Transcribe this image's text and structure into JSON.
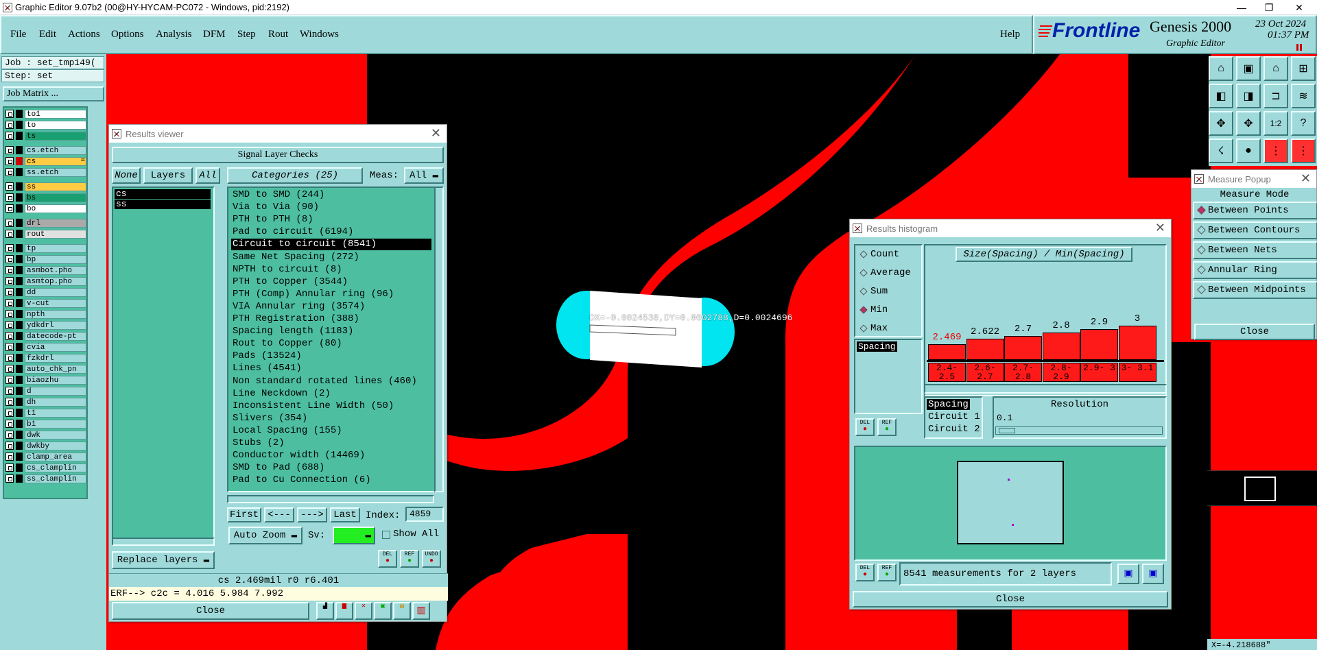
{
  "window": {
    "title": "Graphic Editor 9.07b2 (00@HY-HYCAM-PC072 - Windows, pid:2192)",
    "min": "—",
    "max": "❐",
    "close": "✕"
  },
  "menu": {
    "items": [
      "File",
      "Edit",
      "Actions",
      "Options",
      "Analysis",
      "DFM",
      "Step",
      "Rout",
      "Windows"
    ],
    "help": "Help"
  },
  "brand": {
    "logo": "Frontline",
    "product": "Genesis 2000",
    "subtitle": "Graphic Editor",
    "date": "23 Oct 2024",
    "time": "01:37 PM"
  },
  "left": {
    "job": "Job : set_tmp149(",
    "step": "Step: set",
    "job_matrix": "Job Matrix ...",
    "layers": [
      {
        "name": "to1",
        "color": "#ffffff"
      },
      {
        "name": "to",
        "color": "#ffffff"
      },
      {
        "name": "ts",
        "color": "#1aa070"
      },
      {
        "name": "cs.etch",
        "color": "#9fd9d9"
      },
      {
        "name": "cs",
        "color": "#ffcc44",
        "marker": "="
      },
      {
        "name": "ss.etch",
        "color": "#9fd9d9"
      },
      {
        "name": "ss",
        "color": "#ffcc44"
      },
      {
        "name": "bs",
        "color": "#1aa070"
      },
      {
        "name": "bo",
        "color": "#ffffff"
      },
      {
        "name": "drl",
        "color": "#aaaaaa"
      },
      {
        "name": "rout",
        "color": "#e0e0e0"
      },
      {
        "name": "tp",
        "color": "#9fd9d9"
      },
      {
        "name": "bp",
        "color": "#9fd9d9"
      },
      {
        "name": "asmbot.pho",
        "color": "#9fd9d9"
      },
      {
        "name": "asmtop.pho",
        "color": "#9fd9d9"
      },
      {
        "name": "dd",
        "color": "#9fd9d9"
      },
      {
        "name": "v-cut",
        "color": "#9fd9d9"
      },
      {
        "name": "npth",
        "color": "#9fd9d9"
      },
      {
        "name": "ydkdrl",
        "color": "#9fd9d9"
      },
      {
        "name": "datecode-pt",
        "color": "#9fd9d9"
      },
      {
        "name": "cvia",
        "color": "#9fd9d9"
      },
      {
        "name": "fzkdrl",
        "color": "#9fd9d9"
      },
      {
        "name": "auto_chk_pn",
        "color": "#9fd9d9"
      },
      {
        "name": "biaozhu",
        "color": "#9fd9d9"
      },
      {
        "name": "d",
        "color": "#9fd9d9"
      },
      {
        "name": "dh",
        "color": "#9fd9d9"
      },
      {
        "name": "t1",
        "color": "#9fd9d9"
      },
      {
        "name": "b1",
        "color": "#9fd9d9"
      },
      {
        "name": "dwk",
        "color": "#9fd9d9"
      },
      {
        "name": "dwkby",
        "color": "#9fd9d9"
      },
      {
        "name": "clamp_area",
        "color": "#9fd9d9"
      },
      {
        "name": "cs_clamplin",
        "color": "#9fd9d9"
      },
      {
        "name": "ss_clamplin",
        "color": "#9fd9d9"
      }
    ]
  },
  "results_viewer": {
    "title": "Results viewer",
    "section": "Signal Layer Checks",
    "none_btn": "None",
    "layers_btn": "Layers",
    "all_btn": "All",
    "categories_btn": "Categories (25)",
    "meas_label": "Meas:",
    "meas_value": "All",
    "layer_list": [
      "cs",
      "ss"
    ],
    "categories": [
      "SMD to SMD (244)",
      "Via to Via (90)",
      "PTH to PTH (8)",
      "Pad to circuit (6194)",
      "Circuit to circuit (8541)",
      "Same Net Spacing (272)",
      "NPTH to circuit (8)",
      "PTH to Copper (3544)",
      "PTH (Comp) Annular ring (96)",
      "VIA Annular ring (3574)",
      "PTH Registration (388)",
      "Spacing length (1183)",
      "Rout to Copper (80)",
      "Pads (13524)",
      "Lines (4541)",
      "Non standard rotated lines (460)",
      "Line Neckdown (2)",
      "Inconsistent Line Width (50)",
      "Slivers (354)",
      "Local Spacing (155)",
      "Stubs (2)",
      "Conductor width (14469)",
      "SMD to Pad (688)",
      "Pad to Cu Connection (6)"
    ],
    "selected_index": 4,
    "first": "First",
    "prev": "<---",
    "next": "--->",
    "last": "Last",
    "index_label": "Index:",
    "index_value": "4859",
    "auto_zoom": "Auto Zoom",
    "sv_label": "Sv:",
    "show_all": "Show All",
    "replace_layers": "Replace layers",
    "del": "DEL",
    "ref": "REF",
    "undo": "UNDO",
    "status": "cs 2.469mil  r0  r6.401",
    "erf": "ERF--> c2c = 4.016 5.984 7.992",
    "close": "Close"
  },
  "measure_text": "DX=-0.0024538,DY=0.0002788,D=0.0024696",
  "histogram": {
    "title": "Results histogram",
    "radios": [
      {
        "label": "Count",
        "on": false
      },
      {
        "label": "Average",
        "on": false
      },
      {
        "label": "Sum",
        "on": false
      },
      {
        "label": "Min",
        "on": true
      },
      {
        "label": "Max",
        "on": false
      }
    ],
    "heading": "Size(Spacing) / Min(Spacing)",
    "field": "Spacing",
    "bars": [
      {
        "label": "2.469",
        "range": "2.4- 2.5",
        "value": 2.469,
        "highlight": true
      },
      {
        "label": "2.622",
        "range": "2.6- 2.7",
        "value": 2.622
      },
      {
        "label": "2.7",
        "range": "2.7- 2.8",
        "value": 2.7
      },
      {
        "label": "2.8",
        "range": "2.8- 2.9",
        "value": 2.8
      },
      {
        "label": "2.9",
        "range": "2.9- 3",
        "value": 2.9
      },
      {
        "label": "3",
        "range": "3- 3.1",
        "value": 3.0
      }
    ],
    "attr_list": [
      "Spacing",
      "Circuit 1",
      "Circuit 2"
    ],
    "resolution_label": "Resolution",
    "resolution_value": "0.1",
    "summary": "8541 measurements for 2 layers",
    "del": "DEL",
    "ref": "REF",
    "close": "Close"
  },
  "measure_popup": {
    "title": "Measure Popup",
    "mode_label": "Measure Mode",
    "modes": [
      {
        "label": "Between Points",
        "on": true
      },
      {
        "label": "Between Contours",
        "on": false
      },
      {
        "label": "Between Nets",
        "on": false
      },
      {
        "label": "Annular Ring",
        "on": false
      },
      {
        "label": "Between Midpoints",
        "on": false
      }
    ],
    "close": "Close"
  },
  "coord_text": "X=-4.218688\""
}
